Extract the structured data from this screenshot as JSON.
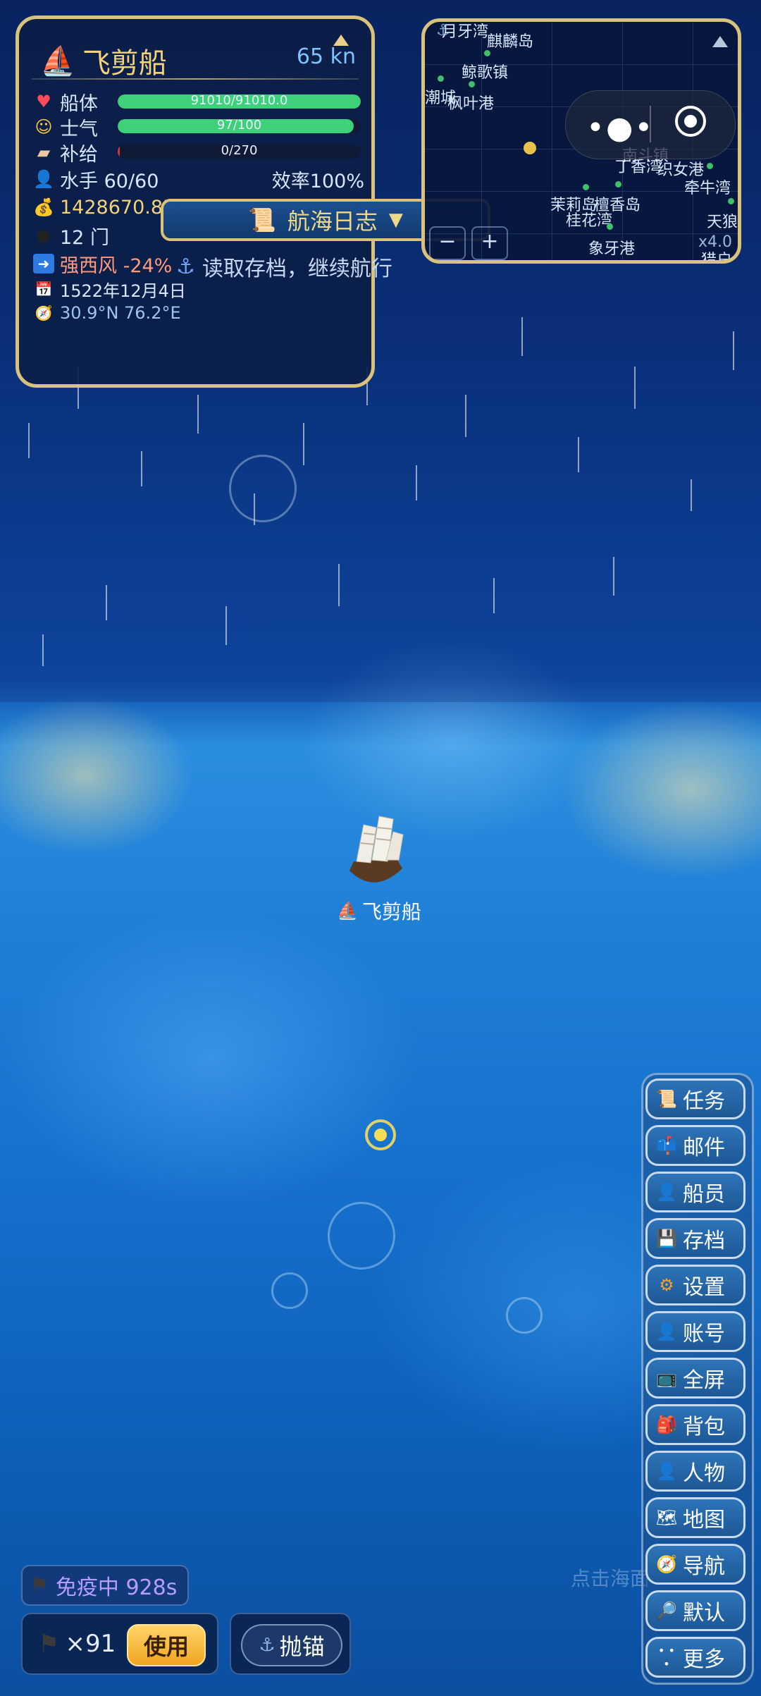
{
  "ship": {
    "name": "飞剪船",
    "speed": "65 kn",
    "hull": {
      "label": "船体",
      "value": "91010/91010.0",
      "fraction": 1.0
    },
    "morale": {
      "label": "士气",
      "value": "97/100",
      "fraction": 0.97
    },
    "supply": {
      "label": "补给",
      "value": "0/270",
      "fraction": 0.0
    },
    "sailors": "水手 60/60",
    "efficiency": "效率100%",
    "gold": "1428670.8575",
    "cannons": "12 门",
    "wind": "强西风 -24%",
    "date": "1522年12月4日",
    "position": "30.9°N  76.2°E"
  },
  "log": {
    "title": "航海日志",
    "hint": "读取存档，继续航行"
  },
  "minimap": {
    "ports": [
      "月牙湾",
      "麒麟岛",
      "鲸歌镇",
      "潮城",
      "枫叶港",
      "南斗镇",
      "丁香湾",
      "织女港",
      "牵牛湾",
      "茉莉岛",
      "檀香岛",
      "桂花湾",
      "天狼",
      "象牙港",
      "猎户"
    ],
    "zoom": "x4.0",
    "minus": "−",
    "plus": "+"
  },
  "capsule": {
    "more": "•●•"
  },
  "ship_label": "飞剪船",
  "menu": [
    {
      "label": "任务",
      "icon": "scroll-icon"
    },
    {
      "label": "邮件",
      "icon": "mailbox-icon"
    },
    {
      "label": "船员",
      "icon": "person-icon"
    },
    {
      "label": "存档",
      "icon": "floppy-icon"
    },
    {
      "label": "设置",
      "icon": "gear-icon"
    },
    {
      "label": "账号",
      "icon": "person-icon"
    },
    {
      "label": "全屏",
      "icon": "tv-icon"
    },
    {
      "label": "背包",
      "icon": "backpack-icon"
    },
    {
      "label": "人物",
      "icon": "person-icon"
    },
    {
      "label": "地图",
      "icon": "map-icon"
    },
    {
      "label": "导航",
      "icon": "compass-icon"
    },
    {
      "label": "默认",
      "icon": "magnifier-icon"
    },
    {
      "label": "更多",
      "icon": "dots-icon"
    }
  ],
  "faint_hint": "点击海面",
  "immune": "免疫中 928s",
  "flag_count": "×91",
  "use_button": "使用",
  "anchor_button": "抛锚",
  "colors": {
    "gold_border": "#d9c27a",
    "hp_green": "#3ed17a",
    "immune_purple": "#b79cff"
  }
}
